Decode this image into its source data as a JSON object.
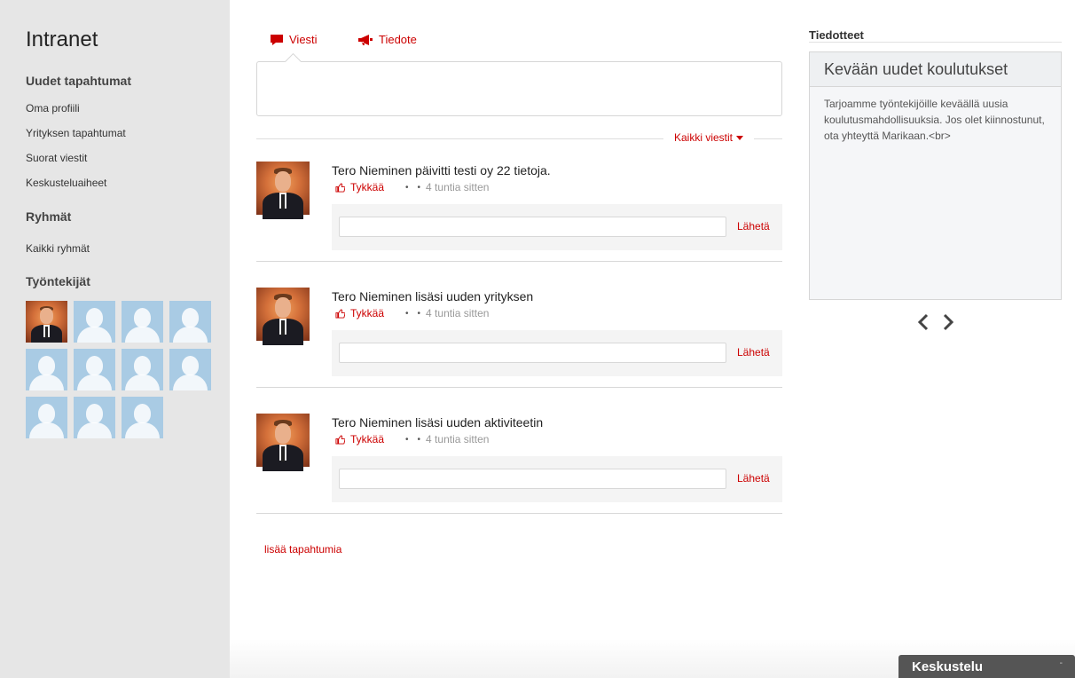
{
  "app": {
    "title": "Intranet"
  },
  "sidebar": {
    "sections": [
      {
        "heading": "Uudet tapahtumat",
        "links": [
          "Oma profiili",
          "Yrityksen tapahtumat",
          "Suorat viestit",
          "Keskusteluaiheet"
        ]
      },
      {
        "heading": "Ryhmät",
        "links": [
          "Kaikki ryhmät"
        ]
      },
      {
        "heading": "Työntekijät",
        "links": []
      }
    ],
    "employees_shown": 11,
    "employees_with_photo": 1
  },
  "composer": {
    "tabs": [
      {
        "label": "Viesti",
        "icon": "speech-bubble-icon",
        "active": true
      },
      {
        "label": "Tiedote",
        "icon": "megaphone-icon",
        "active": false
      }
    ],
    "placeholder": ""
  },
  "feed": {
    "filter_label": "Kaikki viestit",
    "like_label": "Tykkää",
    "send_label": "Lähetä",
    "posts": [
      {
        "text": "Tero Nieminen päivitti testi oy 22 tietoja.",
        "time": "4 tuntia sitten"
      },
      {
        "text": "Tero Nieminen lisäsi uuden yrityksen",
        "time": "4 tuntia sitten"
      },
      {
        "text": "Tero Nieminen lisäsi uuden aktiviteetin",
        "time": "4 tuntia sitten"
      }
    ],
    "more_label": "lisää tapahtumia"
  },
  "notices": {
    "title": "Tiedotteet",
    "card": {
      "heading": "Kevään uudet koulutukset",
      "body": "Tarjoamme työntekijöille keväällä uusia koulutusmahdollisuuksia. Jos olet kiinnostunut, ota yhteyttä Marikaan.<br>"
    }
  },
  "chat": {
    "label": "Keskustelu",
    "minimize_glyph": "-"
  },
  "colors": {
    "accent": "#cc0000",
    "sidebar_bg": "#e6e6e6",
    "chat_bg": "#555555",
    "avatar_placeholder": "#a9cbe4"
  }
}
